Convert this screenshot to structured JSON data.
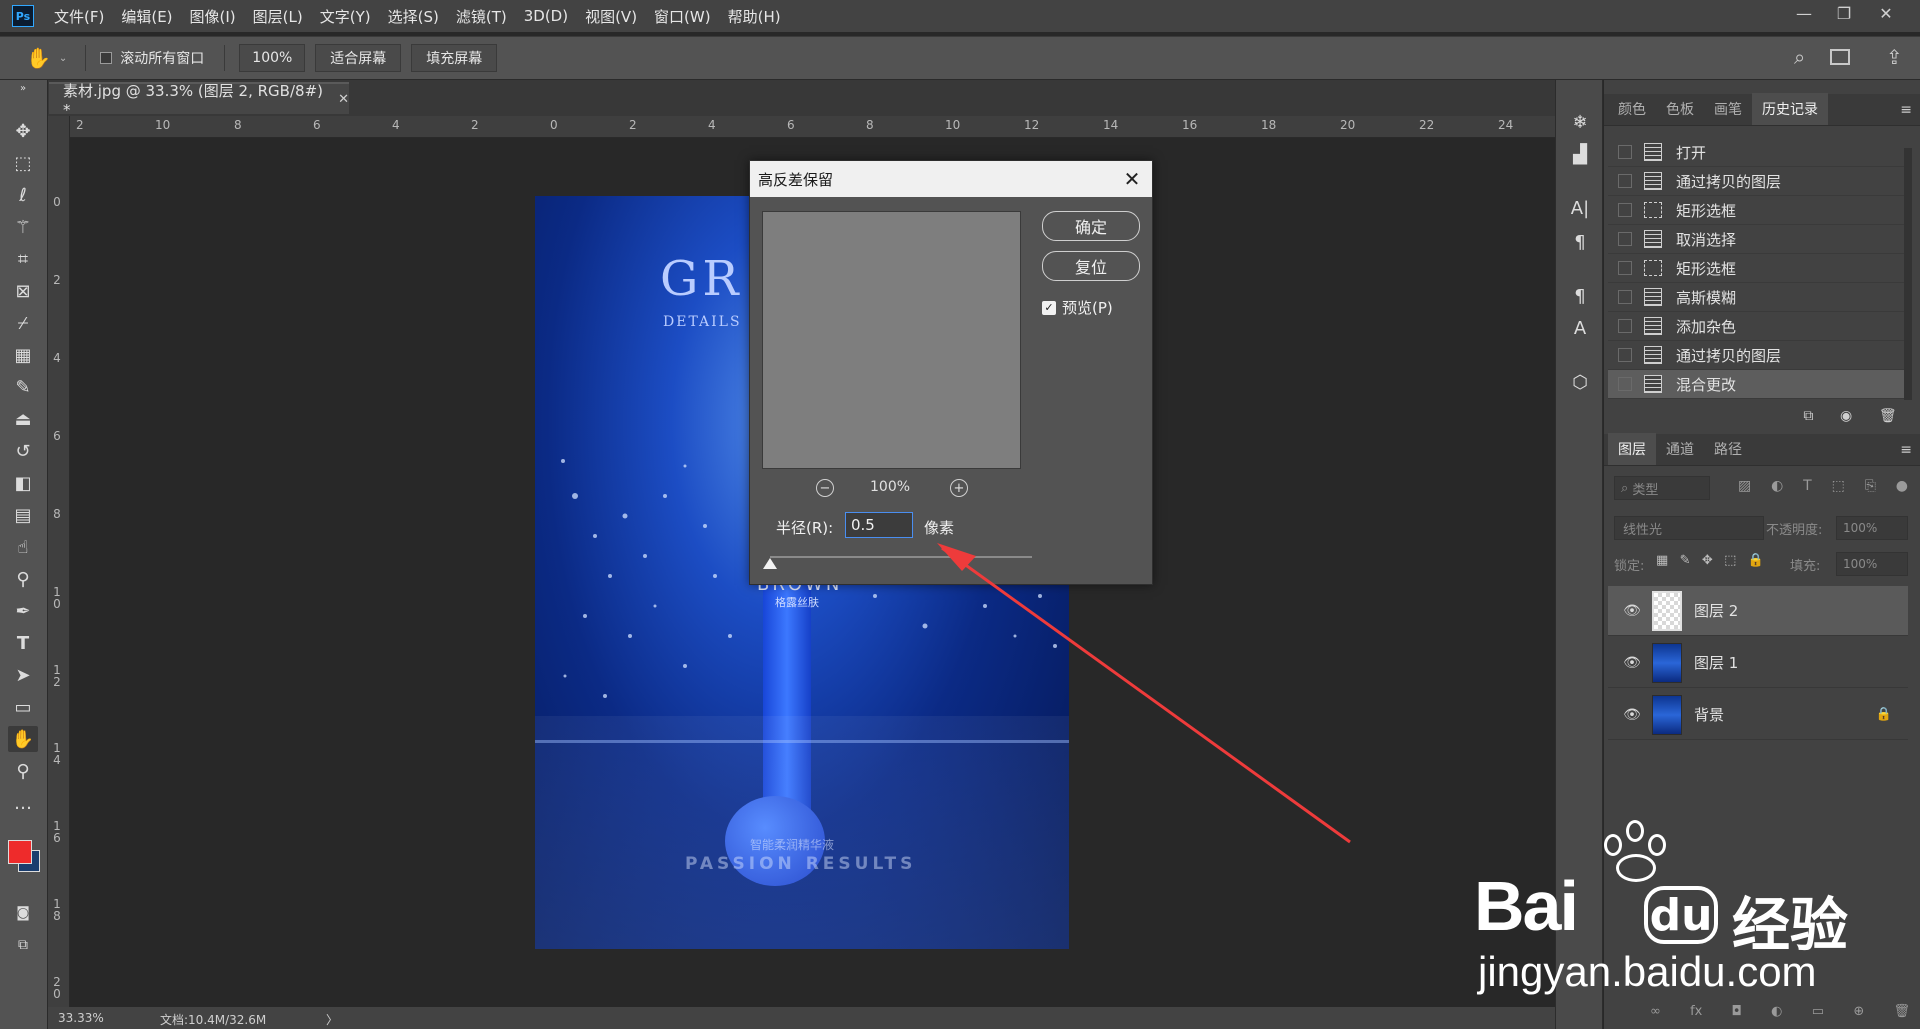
{
  "menubar": {
    "logo": "Ps",
    "items": [
      "文件(F)",
      "编辑(E)",
      "图像(I)",
      "图层(L)",
      "文字(Y)",
      "选择(S)",
      "滤镜(T)",
      "3D(D)",
      "视图(V)",
      "窗口(W)",
      "帮助(H)"
    ],
    "window_controls": [
      "—",
      "❐",
      "✕"
    ]
  },
  "options_bar": {
    "scroll_all_label": "滚动所有窗口",
    "zoom_value": "100%",
    "fit_screen_label": "适合屏幕",
    "fill_screen_label": "填充屏幕"
  },
  "document": {
    "tab_title": "素材.jpg @ 33.3% (图层 2, RGB/8#) *",
    "ruler_h": [
      "2",
      "10",
      "8",
      "6",
      "4",
      "2",
      "0",
      "2",
      "4",
      "6",
      "8",
      "10",
      "12",
      "14",
      "16",
      "18",
      "20",
      "22",
      "24"
    ],
    "ruler_v": [
      "0",
      "2",
      "4",
      "6",
      "8",
      "10",
      "12",
      "14",
      "16",
      "18",
      "20"
    ],
    "status_zoom": "33.33%",
    "status_doc": "文档:10.4M/32.6M",
    "status_arrow": "〉"
  },
  "artwork": {
    "title_text": "GR",
    "subtitle_text": "DETAILS",
    "brand_text": "BROWN",
    "brand_sub": "格露丝肤",
    "bottom_cn": "智能柔润精华液",
    "bottom_en": "PASSION RESULTS"
  },
  "dialog": {
    "title": "高反差保留",
    "close": "✕",
    "ok_label": "确定",
    "reset_label": "复位",
    "preview_label": "预览(P)",
    "preview_checked": true,
    "zoom_out_icon": "−",
    "zoom_level": "100%",
    "zoom_in_icon": "+",
    "radius_label": "半径(R):",
    "radius_value": "0.5",
    "radius_unit": "像素",
    "slider_position": 0.0
  },
  "history_panel": {
    "tabs": [
      "颜色",
      "色板",
      "画笔",
      "历史记录"
    ],
    "active_tab": "历史记录",
    "items": [
      {
        "label": "打开",
        "icon": "doc"
      },
      {
        "label": "通过拷贝的图层",
        "icon": "doc"
      },
      {
        "label": "矩形选框",
        "icon": "marquee"
      },
      {
        "label": "取消选择",
        "icon": "doc"
      },
      {
        "label": "矩形选框",
        "icon": "marquee"
      },
      {
        "label": "高斯模糊",
        "icon": "doc"
      },
      {
        "label": "添加杂色",
        "icon": "doc"
      },
      {
        "label": "通过拷贝的图层",
        "icon": "doc"
      },
      {
        "label": "混合更改",
        "icon": "doc"
      }
    ],
    "selected_index": 8
  },
  "layers_panel": {
    "tabs": [
      "图层",
      "通道",
      "路径"
    ],
    "filter_placeholder": "类型",
    "blend_mode": "线性光",
    "opacity_label": "不透明度:",
    "opacity_value": "100%",
    "lock_label": "锁定:",
    "fill_label": "填充:",
    "fill_value": "100%",
    "layers": [
      {
        "name": "图层 2",
        "thumb": "check",
        "locked": false
      },
      {
        "name": "图层 1",
        "thumb": "blue",
        "locked": false
      },
      {
        "name": "背景",
        "thumb": "blue",
        "locked": true
      }
    ],
    "selected_index": 0,
    "footer_icons": [
      "∞",
      "fx",
      "◘",
      "◐",
      "▭",
      "⊕",
      "🗑"
    ]
  },
  "watermark": {
    "brand": "Bai",
    "brand_du": "du",
    "brand_cn": "经验",
    "url": "jingyan.baidu.com"
  },
  "colors": {
    "foreground": "#ee2b2b",
    "background": "#1a3d6e",
    "arrow": "#ee3b3b"
  }
}
